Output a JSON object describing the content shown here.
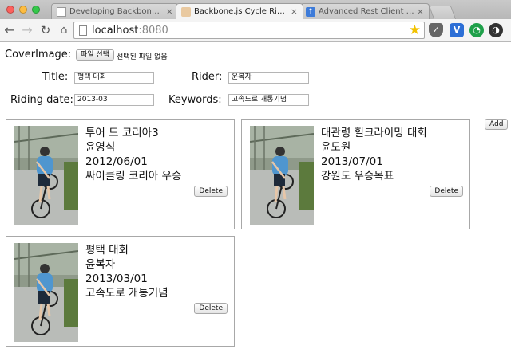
{
  "browser": {
    "tabs": [
      {
        "title": "Developing Backbone.js Ap",
        "favicon": "document-icon",
        "active": false
      },
      {
        "title": "Backbone.js Cycle Riding Fi",
        "favicon": "person-icon",
        "active": true
      },
      {
        "title": "Advanced Rest Client Appli",
        "favicon": "rest-client-icon",
        "active": false
      }
    ],
    "close_glyph": "×",
    "url_host": "localhost",
    "url_port": ":8080"
  },
  "form": {
    "cover_label": "CoverImage:",
    "file_button": "파일 선택",
    "file_status": "선택된 파일 없음",
    "title_label": "Title:",
    "title_value": "평택 대회",
    "rider_label": "Rider:",
    "rider_value": "윤복자",
    "date_label": "Riding date:",
    "date_value": "2013-03",
    "keywords_label": "Keywords:",
    "keywords_value": "고속도로 개통기념",
    "add_button": "Add"
  },
  "rides": [
    {
      "title": "투어 드 코리아3",
      "rider": "윤영식",
      "date": "2012/06/01",
      "keywords": "싸이클링 코리아 우승",
      "delete_label": "Delete"
    },
    {
      "title": "대관령 힐크라이밍 대회",
      "rider": "윤도원",
      "date": "2013/07/01",
      "keywords": "강원도 우승목표",
      "delete_label": "Delete"
    },
    {
      "title": "평택 대회",
      "rider": "윤복자",
      "date": "2013/03/01",
      "keywords": "고속도로 개통기념",
      "delete_label": "Delete"
    }
  ],
  "colors": {
    "jersey": "#4f96cf",
    "road": "#b9bcb8",
    "grass": "#5c7a3d"
  }
}
